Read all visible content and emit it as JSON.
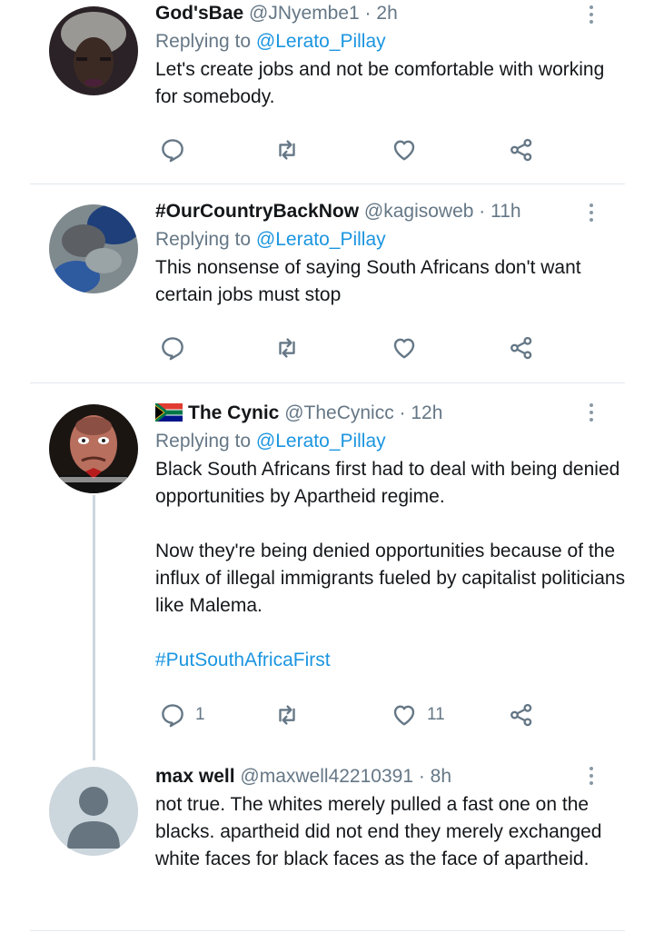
{
  "tweets": [
    {
      "name": "God'sBae",
      "meta": "@JNyembe1 · 2h",
      "replying_prefix": "Replying to",
      "replying_to": "@Lerato_Pillay",
      "text": [
        "Let's create jobs and not be comfortable with working for somebody."
      ],
      "hashtag": "",
      "counts": {
        "reply": "",
        "retweet": "",
        "like": ""
      }
    },
    {
      "name": "#OurCountryBackNow",
      "meta": "@kagisoweb · 11h",
      "replying_prefix": "Replying to",
      "replying_to": "@Lerato_Pillay",
      "text": [
        "This nonsense of saying South Africans don't want certain jobs must stop"
      ],
      "hashtag": "",
      "counts": {
        "reply": "",
        "retweet": "",
        "like": ""
      }
    },
    {
      "name": "The Cynic",
      "meta": "@TheCynicc · 12h",
      "replying_prefix": "Replying to",
      "replying_to": "@Lerato_Pillay",
      "text": [
        "Black South Africans first had to deal with being denied opportunities by Apartheid regime.",
        "Now they're being denied opportunities because of the influx of illegal immigrants fueled by capitalist politicians like Malema."
      ],
      "hashtag": "#PutSouthAfricaFirst",
      "counts": {
        "reply": "1",
        "retweet": "",
        "like": "11"
      }
    },
    {
      "name": "max well",
      "meta": "@maxwell42210391 · 8h",
      "text": [
        "not true. The whites merely pulled a fast one on the blacks. apartheid did not end they merely exchanged white faces for black faces as the face of apartheid."
      ]
    }
  ],
  "icons": {
    "reply": "reply-icon",
    "retweet": "retweet-icon",
    "like": "like-icon",
    "share": "share-icon",
    "more": "more-icon",
    "flag": "south-africa-flag-icon"
  },
  "colors": {
    "link": "#1b95e0",
    "muted": "#657786",
    "divider": "#e1e8ed"
  }
}
